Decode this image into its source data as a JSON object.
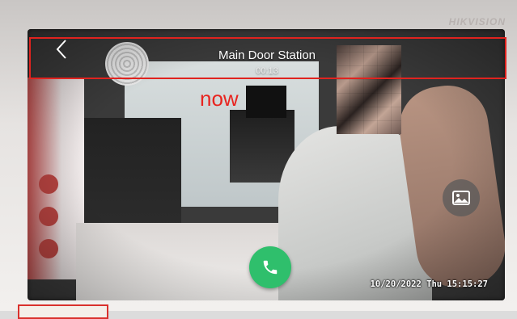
{
  "device": {
    "brand": "HIKVISION"
  },
  "call": {
    "title": "Main Door Station",
    "duration": "00:13",
    "timestamp": "10/20/2022 Thu 15:15:27"
  },
  "annotation": {
    "label": "now",
    "color": "#e0231f"
  },
  "icons": {
    "back": "chevron-left-icon",
    "snapshot": "image-icon",
    "answer": "phone-icon"
  },
  "colors": {
    "answer_button": "#2fbf6c"
  }
}
